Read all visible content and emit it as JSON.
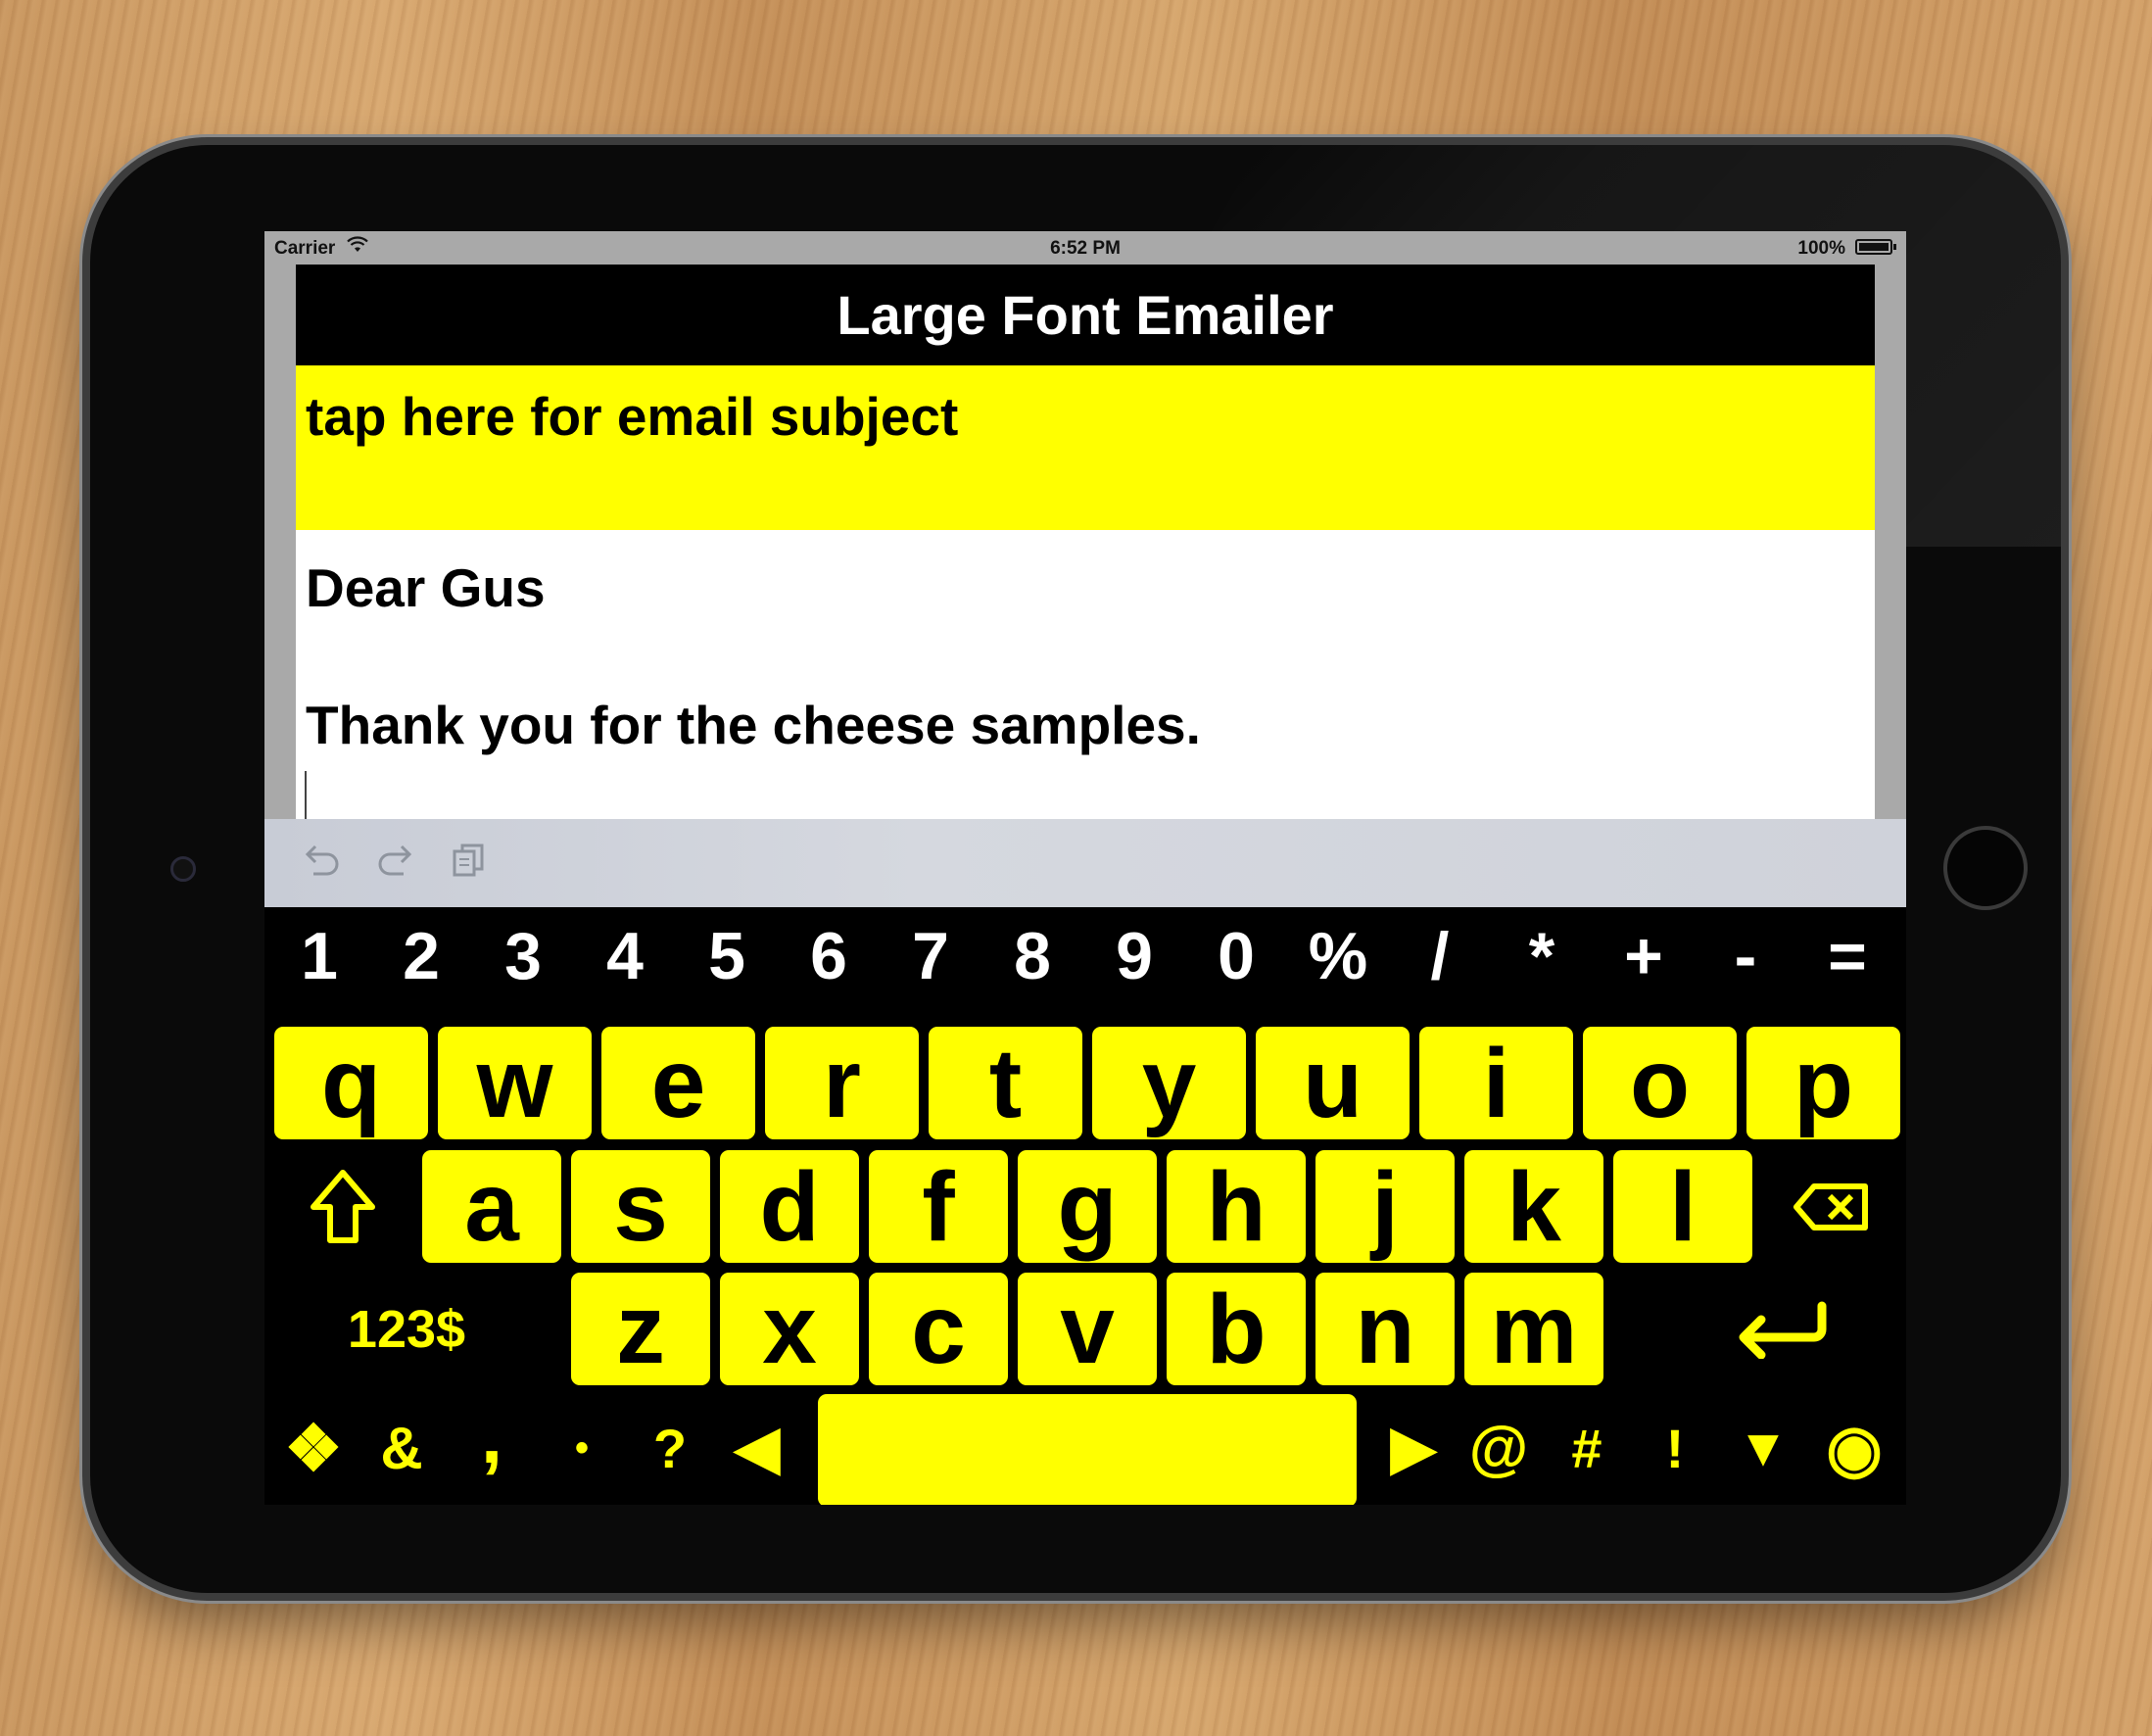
{
  "status_bar": {
    "carrier": "Carrier",
    "time": "6:52 PM",
    "battery": "100%"
  },
  "app": {
    "title": "Large Font Emailer",
    "subject_placeholder": "tap here for email subject",
    "body_lines": [
      "Dear Gus",
      "",
      "Thank you for the cheese samples."
    ]
  },
  "assistant_bar": {
    "icons": [
      "undo-icon",
      "redo-icon",
      "paste-icon"
    ]
  },
  "keyboard": {
    "number_row": [
      "1",
      "2",
      "3",
      "4",
      "5",
      "6",
      "7",
      "8",
      "9",
      "0",
      "%",
      "/",
      "*",
      "+",
      "-",
      "="
    ],
    "row1": [
      "q",
      "w",
      "e",
      "r",
      "t",
      "y",
      "u",
      "i",
      "o",
      "p"
    ],
    "row2": [
      "a",
      "s",
      "d",
      "f",
      "g",
      "h",
      "j",
      "k",
      "l"
    ],
    "row3": [
      "z",
      "x",
      "c",
      "v",
      "b",
      "n",
      "m"
    ],
    "shift_icon": "shift-arrow-icon",
    "backspace_icon": "backspace-icon",
    "mode_label": "123$",
    "return_icon": "return-arrow-icon",
    "bottom_left": [
      {
        "name": "cursor-pad-icon",
        "label": "❖"
      },
      {
        "name": "ampersand-key",
        "label": "&"
      },
      {
        "name": "comma-key",
        "label": ","
      },
      {
        "name": "period-key",
        "label": "•"
      },
      {
        "name": "question-key",
        "label": "?"
      },
      {
        "name": "cursor-left-icon",
        "label": "◀"
      }
    ],
    "bottom_right": [
      {
        "name": "cursor-right-icon",
        "label": "▶"
      },
      {
        "name": "at-key",
        "label": "@"
      },
      {
        "name": "hash-key",
        "label": "#"
      },
      {
        "name": "exclamation-key",
        "label": "!"
      },
      {
        "name": "hide-keyboard-icon",
        "label": "▼"
      },
      {
        "name": "send-icon",
        "label": "◉"
      }
    ],
    "colors": {
      "key_fill": "#ffff00",
      "key_text": "#000000",
      "background": "#000000",
      "number_text": "#ffffff"
    }
  }
}
